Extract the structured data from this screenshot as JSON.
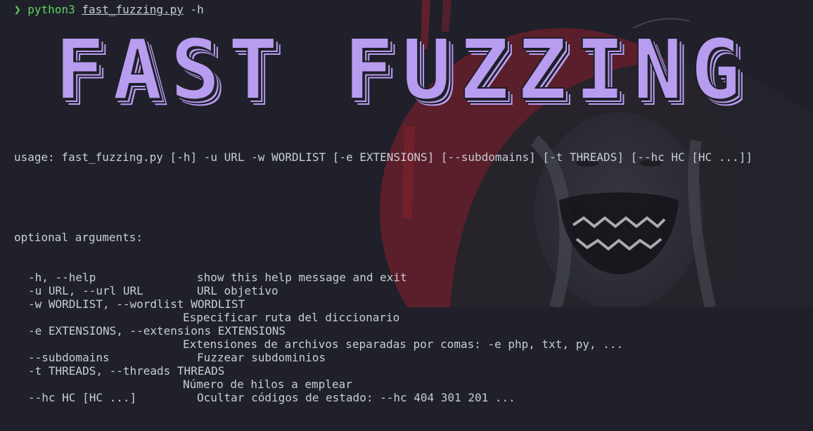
{
  "terminal": {
    "prompt_symbol": "❯",
    "command": "python3",
    "script": "fast_fuzzing.py",
    "flag": "-h"
  },
  "banner": {
    "text": "FAST FUZZING"
  },
  "usage": "usage: fast_fuzzing.py [-h] -u URL -w WORDLIST [-e EXTENSIONS] [--subdomains] [-t THREADS] [--hc HC [HC ...]]",
  "section_title": "optional arguments:",
  "options": [
    {
      "flag": "-h, --help",
      "desc": "show this help message and exit"
    },
    {
      "flag": "-u URL, --url URL",
      "desc": "URL objetivo"
    },
    {
      "flag": "-w WORDLIST, --wordlist WORDLIST",
      "desc": ""
    },
    {
      "flag": "",
      "desc": "Especificar ruta del diccionario"
    },
    {
      "flag": "-e EXTENSIONS, --extensions EXTENSIONS",
      "desc": ""
    },
    {
      "flag": "",
      "desc": "Extensiones de archivos separadas por comas: -e php, txt, py, ..."
    },
    {
      "flag": "--subdomains",
      "desc": "Fuzzear subdominios"
    },
    {
      "flag": "-t THREADS, --threads THREADS",
      "desc": ""
    },
    {
      "flag": "",
      "desc": "Número de hilos a emplear"
    },
    {
      "flag": "--hc HC [HC ...]",
      "desc": "Ocultar códigos de estado: --hc 404 301 201 ..."
    }
  ],
  "colors": {
    "background": "#1f2029",
    "prompt": "#5fd35f",
    "banner": "#b89cf0",
    "text": "#c9ccd6",
    "art_red": "#8a1f2e"
  }
}
